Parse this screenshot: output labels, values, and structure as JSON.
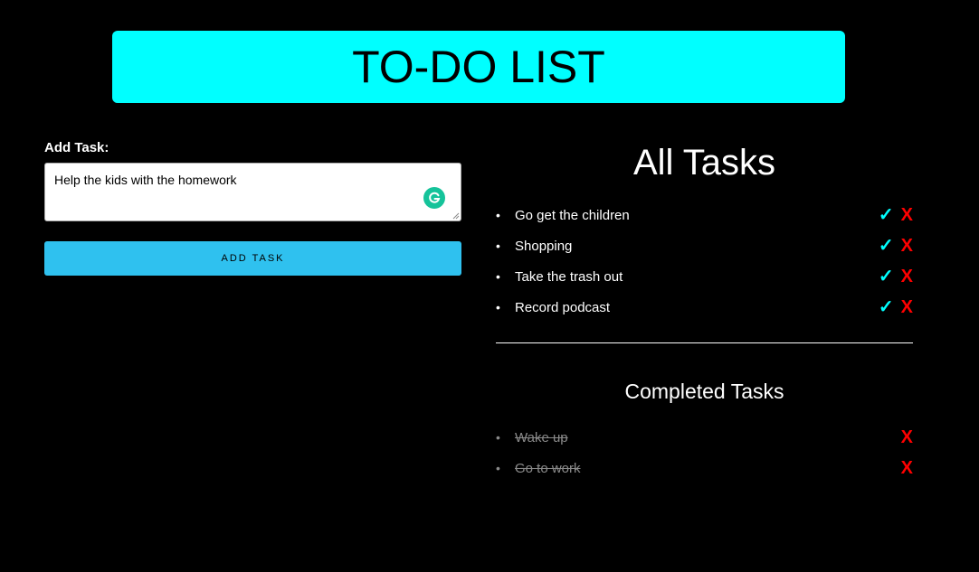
{
  "header": {
    "title": "TO-DO LIST"
  },
  "form": {
    "label": "Add Task:",
    "textarea_value": "Help the kids with the homework",
    "button_label": "ADD TASK"
  },
  "all_tasks": {
    "title": "All Tasks",
    "items": [
      {
        "label": "Go get the children"
      },
      {
        "label": "Shopping"
      },
      {
        "label": "Take the trash out"
      },
      {
        "label": "Record podcast"
      }
    ]
  },
  "completed_tasks": {
    "title": "Completed Tasks",
    "items": [
      {
        "label": "Wake up"
      },
      {
        "label": "Go to work"
      }
    ]
  },
  "icons": {
    "check": "✓",
    "delete": "X",
    "bullet": "•"
  },
  "colors": {
    "background": "#000000",
    "header_bg": "#00ffff",
    "button_bg": "#2fc1ef",
    "check": "#00ffff",
    "delete": "#ff0000",
    "completed_text": "#8a8a8a",
    "grammarly": "#15c39a"
  }
}
